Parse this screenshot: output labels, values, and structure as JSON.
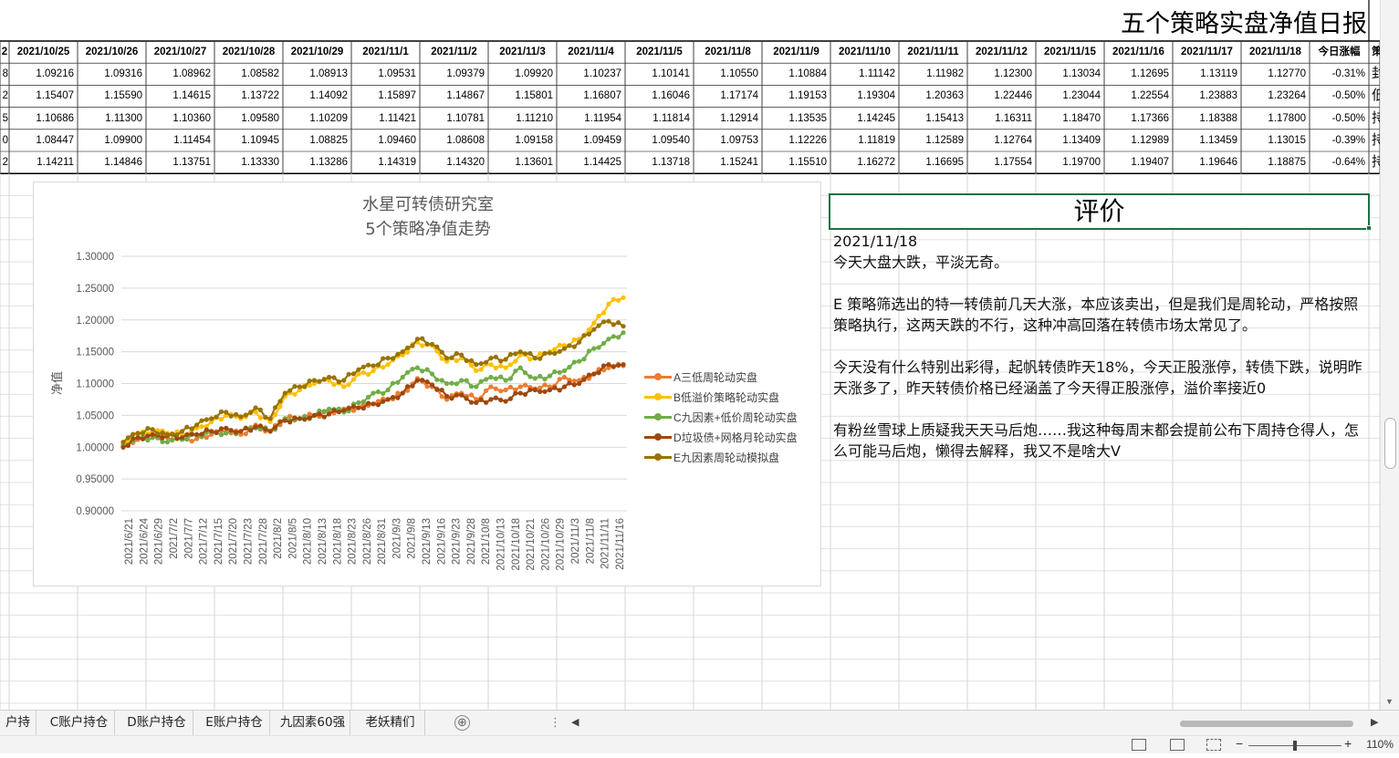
{
  "sheet": {
    "banner": "五个策略实盘净值日报",
    "header_prefix": "2",
    "dates": [
      "2021/10/25",
      "2021/10/26",
      "2021/10/27",
      "2021/10/28",
      "2021/10/29",
      "2021/11/1",
      "2021/11/2",
      "2021/11/3",
      "2021/11/4",
      "2021/11/5",
      "2021/11/8",
      "2021/11/9",
      "2021/11/10",
      "2021/11/11",
      "2021/11/12",
      "2021/11/15",
      "2021/11/16",
      "2021/11/17",
      "2021/11/18"
    ],
    "change_header": "今日涨幅",
    "partial_col_header": "策",
    "rows": [
      {
        "prefix": "8",
        "values": [
          "1.09216",
          "1.09316",
          "1.08962",
          "1.08582",
          "1.08913",
          "1.09531",
          "1.09379",
          "1.09920",
          "1.10237",
          "1.10141",
          "1.10550",
          "1.10884",
          "1.11142",
          "1.11982",
          "1.12300",
          "1.13034",
          "1.12695",
          "1.13119",
          "1.12770"
        ],
        "change": "-0.31%",
        "tail": "封"
      },
      {
        "prefix": "2",
        "values": [
          "1.15407",
          "1.15590",
          "1.14615",
          "1.13722",
          "1.14092",
          "1.15897",
          "1.14867",
          "1.15801",
          "1.16807",
          "1.16046",
          "1.17174",
          "1.19153",
          "1.19304",
          "1.20363",
          "1.22446",
          "1.23044",
          "1.22554",
          "1.23883",
          "1.23264"
        ],
        "change": "-0.50%",
        "tail": "低"
      },
      {
        "prefix": "5",
        "values": [
          "1.10686",
          "1.11300",
          "1.10360",
          "1.09580",
          "1.10209",
          "1.11421",
          "1.10781",
          "1.11210",
          "1.11954",
          "1.11814",
          "1.12914",
          "1.13535",
          "1.14245",
          "1.15413",
          "1.16311",
          "1.18470",
          "1.17366",
          "1.18388",
          "1.17800"
        ],
        "change": "-0.50%",
        "tail": "持"
      },
      {
        "prefix": "0",
        "values": [
          "1.08447",
          "1.09900",
          "1.11454",
          "1.10945",
          "1.08825",
          "1.09460",
          "1.08608",
          "1.09158",
          "1.09459",
          "1.09540",
          "1.09753",
          "1.12226",
          "1.11819",
          "1.12589",
          "1.12764",
          "1.13409",
          "1.12989",
          "1.13459",
          "1.13015"
        ],
        "change": "-0.39%",
        "tail": "持"
      },
      {
        "prefix": "2",
        "values": [
          "1.14211",
          "1.14846",
          "1.13751",
          "1.13330",
          "1.13286",
          "1.14319",
          "1.14320",
          "1.13601",
          "1.14425",
          "1.13718",
          "1.15241",
          "1.15510",
          "1.16272",
          "1.16695",
          "1.17554",
          "1.19700",
          "1.19407",
          "1.19646",
          "1.18875"
        ],
        "change": "-0.64%",
        "tail": "持"
      }
    ]
  },
  "chart_data": {
    "type": "line",
    "title": "水星可转债研究室",
    "subtitle": "5个策略净值走势",
    "xlabel": "",
    "ylabel": "净值",
    "ylim": [
      0.9,
      1.3
    ],
    "y_ticks": [
      "1.30000",
      "1.25000",
      "1.20000",
      "1.15000",
      "1.10000",
      "1.05000",
      "1.00000",
      "0.95000",
      "0.90000"
    ],
    "x_tick_labels": [
      "2021/6/21",
      "2021/6/24",
      "2021/6/29",
      "2021/7/2",
      "2021/7/7",
      "2021/7/12",
      "2021/7/15",
      "2021/7/20",
      "2021/7/23",
      "2021/7/28",
      "2021/8/2",
      "2021/8/5",
      "2021/8/10",
      "2021/8/13",
      "2021/8/18",
      "2021/8/23",
      "2021/8/26",
      "2021/8/31",
      "2021/9/3",
      "2021/9/8",
      "2021/9/13",
      "2021/9/16",
      "2021/9/23",
      "2021/9/28",
      "2021/10/8",
      "2021/10/13",
      "2021/10/18",
      "2021/10/21",
      "2021/10/26",
      "2021/10/29",
      "2021/11/3",
      "2021/11/8",
      "2021/11/11",
      "2021/11/16"
    ],
    "grid": true,
    "legend_position": "right",
    "series": [
      {
        "name": "A三低周轮动实盘",
        "color": "#ed7d31",
        "values": [
          1.0,
          1.012,
          1.018,
          1.015,
          1.014,
          1.013,
          1.02,
          1.025,
          1.02,
          1.035,
          1.025,
          1.045,
          1.045,
          1.05,
          1.055,
          1.06,
          1.062,
          1.068,
          1.075,
          1.085,
          1.108,
          1.095,
          1.075,
          1.085,
          1.075,
          1.095,
          1.09,
          1.095,
          1.092,
          1.095,
          1.11,
          1.105,
          1.115,
          1.125,
          1.128
        ]
      },
      {
        "name": "B低溢价策略轮动实盘",
        "color": "#ffc000",
        "values": [
          1.005,
          1.018,
          1.025,
          1.022,
          1.02,
          1.03,
          1.04,
          1.05,
          1.045,
          1.055,
          1.04,
          1.08,
          1.09,
          1.1,
          1.105,
          1.095,
          1.115,
          1.12,
          1.13,
          1.145,
          1.165,
          1.16,
          1.135,
          1.14,
          1.12,
          1.13,
          1.125,
          1.145,
          1.14,
          1.15,
          1.16,
          1.17,
          1.195,
          1.225,
          1.235
        ]
      },
      {
        "name": "C九因素+低价周轮动实盘",
        "color": "#70ad47",
        "values": [
          1.003,
          1.015,
          1.015,
          1.008,
          1.012,
          1.018,
          1.025,
          1.022,
          1.025,
          1.03,
          1.025,
          1.045,
          1.045,
          1.05,
          1.06,
          1.055,
          1.07,
          1.085,
          1.09,
          1.11,
          1.125,
          1.115,
          1.1,
          1.105,
          1.095,
          1.11,
          1.105,
          1.125,
          1.108,
          1.112,
          1.12,
          1.135,
          1.155,
          1.17,
          1.18
        ]
      },
      {
        "name": "D垃圾债+网格月轮动实盘",
        "color": "#9e480e",
        "values": [
          1.0,
          1.015,
          1.02,
          1.018,
          1.015,
          1.02,
          1.025,
          1.03,
          1.025,
          1.032,
          1.025,
          1.042,
          1.045,
          1.05,
          1.052,
          1.058,
          1.062,
          1.068,
          1.075,
          1.085,
          1.105,
          1.098,
          1.08,
          1.082,
          1.07,
          1.075,
          1.072,
          1.085,
          1.09,
          1.09,
          1.095,
          1.1,
          1.115,
          1.13,
          1.13
        ]
      },
      {
        "name": "E九因素周轮动模拟盘",
        "color": "#997300",
        "values": [
          1.008,
          1.022,
          1.028,
          1.02,
          1.025,
          1.035,
          1.045,
          1.055,
          1.048,
          1.062,
          1.045,
          1.085,
          1.095,
          1.105,
          1.11,
          1.105,
          1.122,
          1.128,
          1.14,
          1.15,
          1.17,
          1.162,
          1.14,
          1.145,
          1.13,
          1.14,
          1.138,
          1.15,
          1.14,
          1.148,
          1.155,
          1.165,
          1.185,
          1.198,
          1.19
        ]
      }
    ]
  },
  "evaluation": {
    "title": "评价",
    "date": "2021/11/18",
    "paragraphs": [
      "今天大盘大跌，平淡无奇。",
      "",
      "E 策略筛选出的特一转债前几天大涨，本应该卖出，但是我们是周轮动，严格按照策略执行，这两天跌的不行，这种冲高回落在转债市场太常见了。",
      "",
      "今天没有什么特别出彩得，起帆转债昨天18%，今天正股涨停，转债下跌，说明昨天涨多了，昨天转债价格已经涵盖了今天得正股涨停，溢价率接近0",
      "",
      "有粉丝雪球上质疑我天天马后炮……我这种每周末都会提前公布下周持仓得人，怎么可能马后炮，懒得去解释，我又不是啥大V"
    ]
  },
  "tabs": [
    "户持仓",
    "C账户持仓",
    "D账户持仓",
    "E账户持仓",
    "九因素60强",
    "老妖精们"
  ],
  "add_sheet": "⊕",
  "tab_menu": "⋮",
  "scroll_left": "◀",
  "scroll_right": "▶",
  "zoom": {
    "minus": "−",
    "plus": "+",
    "level": "110%"
  }
}
